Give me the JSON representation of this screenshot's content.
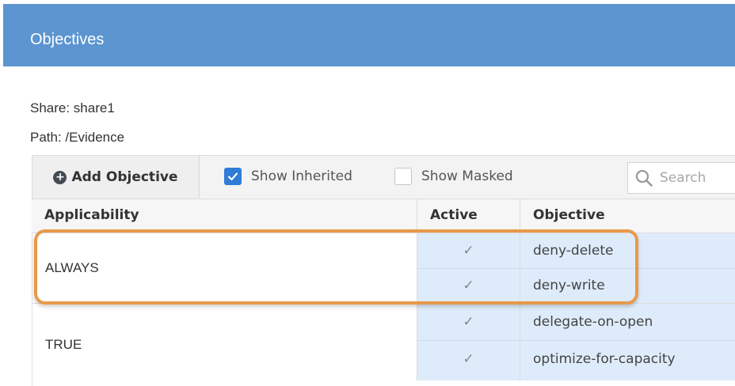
{
  "header": {
    "title": "Objectives"
  },
  "info": {
    "share": "Share: share1",
    "path": "Path: /Evidence"
  },
  "toolbar": {
    "add_objective_label": "Add Objective",
    "add_icon": "plus-circle-icon",
    "show_inherited": {
      "label": "Show Inherited",
      "checked": true
    },
    "show_masked": {
      "label": "Show Masked",
      "checked": false
    },
    "search": {
      "placeholder": "Search",
      "value": "",
      "icon": "search-icon"
    }
  },
  "table": {
    "columns": [
      "Applicability",
      "Active",
      "Objective"
    ],
    "groups": [
      {
        "applicability": "ALWAYS",
        "rows": [
          {
            "active": "✓",
            "objective": "deny-delete"
          },
          {
            "active": "✓",
            "objective": "deny-write"
          }
        ]
      },
      {
        "applicability": "TRUE",
        "rows": [
          {
            "active": "✓",
            "objective": "delegate-on-open"
          },
          {
            "active": "✓",
            "objective": "optimize-for-capacity"
          }
        ]
      }
    ]
  },
  "colors": {
    "header_bg": "#5c95d0",
    "row_highlight": "#deebfa",
    "checkbox_checked": "#2f7bd6",
    "callout_outline": "#e8994a"
  }
}
